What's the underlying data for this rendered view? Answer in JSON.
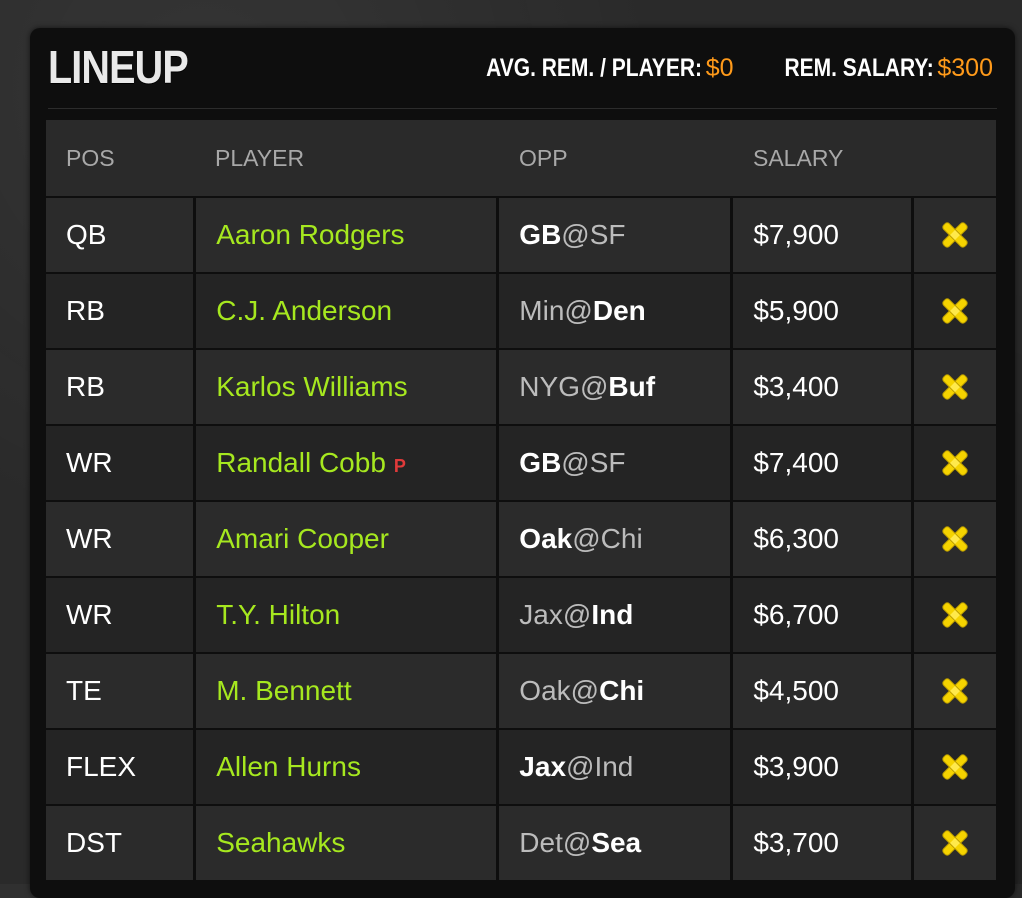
{
  "header": {
    "title": "LINEUP",
    "avg_label": "AVG. REM. / PLAYER:",
    "avg_value": "$0",
    "rem_label": "REM. SALARY:",
    "rem_value": "$300"
  },
  "columns": [
    "POS",
    "PLAYER",
    "OPP",
    "SALARY"
  ],
  "rows": [
    {
      "pos": "QB",
      "player": "Aaron Rodgers",
      "tag": "",
      "away": "GB",
      "home": "SF",
      "bold": "away",
      "salary": "$7,900"
    },
    {
      "pos": "RB",
      "player": "C.J. Anderson",
      "tag": "",
      "away": "Min",
      "home": "Den",
      "bold": "home",
      "salary": "$5,900"
    },
    {
      "pos": "RB",
      "player": "Karlos Williams",
      "tag": "",
      "away": "NYG",
      "home": "Buf",
      "bold": "home",
      "salary": "$3,400"
    },
    {
      "pos": "WR",
      "player": "Randall Cobb",
      "tag": "P",
      "away": "GB",
      "home": "SF",
      "bold": "away",
      "salary": "$7,400"
    },
    {
      "pos": "WR",
      "player": "Amari Cooper",
      "tag": "",
      "away": "Oak",
      "home": "Chi",
      "bold": "away",
      "salary": "$6,300"
    },
    {
      "pos": "WR",
      "player": "T.Y. Hilton",
      "tag": "",
      "away": "Jax",
      "home": "Ind",
      "bold": "home",
      "salary": "$6,700"
    },
    {
      "pos": "TE",
      "player": "M. Bennett",
      "tag": "",
      "away": "Oak",
      "home": "Chi",
      "bold": "home",
      "salary": "$4,500"
    },
    {
      "pos": "FLEX",
      "player": "Allen Hurns",
      "tag": "",
      "away": "Jax",
      "home": "Ind",
      "bold": "away",
      "salary": "$3,900"
    },
    {
      "pos": "DST",
      "player": "Seahawks",
      "tag": "",
      "away": "Det",
      "home": "Sea",
      "bold": "home",
      "salary": "$3,700"
    }
  ],
  "remove_icon": "remove-x-icon",
  "colors": {
    "accent": "#a6e81f",
    "money": "#ff9a1a",
    "probable": "#e03a3a",
    "remove": "#f5d300"
  }
}
